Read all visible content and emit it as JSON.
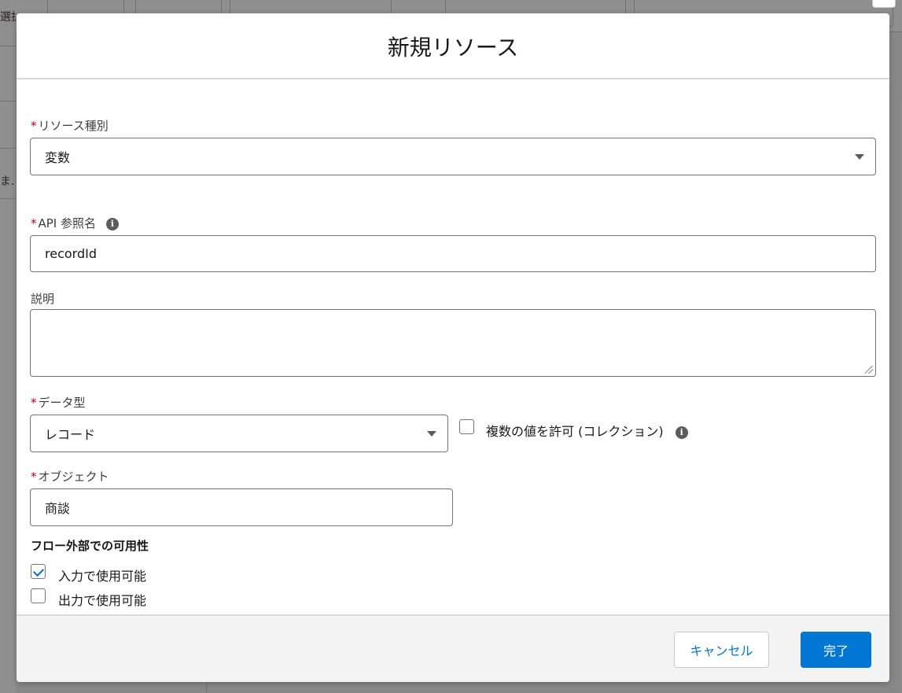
{
  "background": {
    "left_items": [
      "選択",
      "ま..."
    ]
  },
  "modal": {
    "title": "新規リソース",
    "resource_type": {
      "label": "リソース種別",
      "value": "変数"
    },
    "api_name": {
      "label": "API 参照名",
      "value": "recordId"
    },
    "description": {
      "label": "説明",
      "value": ""
    },
    "data_type": {
      "label": "データ型",
      "value": "レコード"
    },
    "allow_multiple": {
      "label": "複数の値を許可 (コレクション)",
      "checked": false
    },
    "object": {
      "label": "オブジェクト",
      "value": "商談"
    },
    "availability": {
      "title": "フロー外部での可用性",
      "input": {
        "label": "入力で使用可能",
        "checked": true
      },
      "output": {
        "label": "出力で使用可能",
        "checked": false
      }
    },
    "footer": {
      "cancel_label": "キャンセル",
      "done_label": "完了"
    }
  },
  "colors": {
    "brand": "#0176d3",
    "required": "#ba0517"
  }
}
